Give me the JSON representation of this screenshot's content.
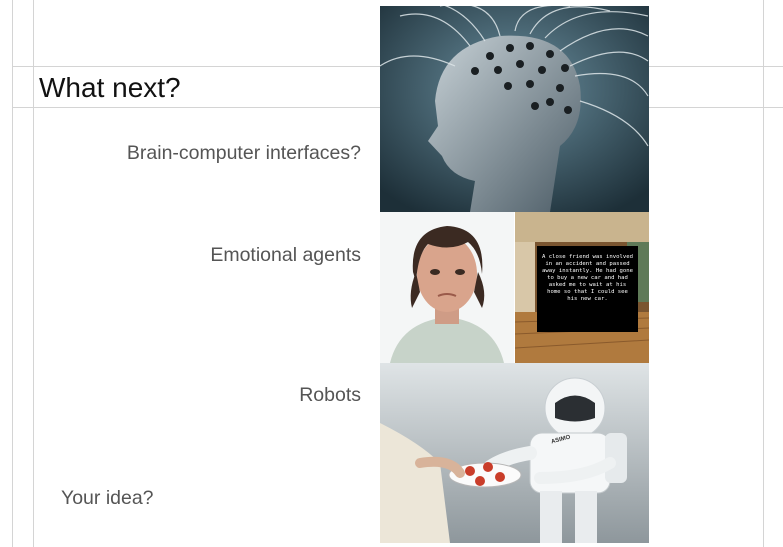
{
  "slide": {
    "title": "What next?",
    "items": [
      {
        "label": "Brain-computer interfaces?",
        "image_icon": "eeg-cap-head-icon"
      },
      {
        "label": "Emotional agents",
        "image_icon": "virtual-human-face-icon"
      },
      {
        "label": "Robots",
        "image_icon": "asimo-robot-icon"
      },
      {
        "label": "Your idea?"
      }
    ],
    "emotion_scene_text": "A close friend was involved in an accident and passed away instantly. He had gone to buy a new car and had asked me to wait at his home so that I could see his new car.",
    "robot_logo_text": "ASIMO"
  }
}
